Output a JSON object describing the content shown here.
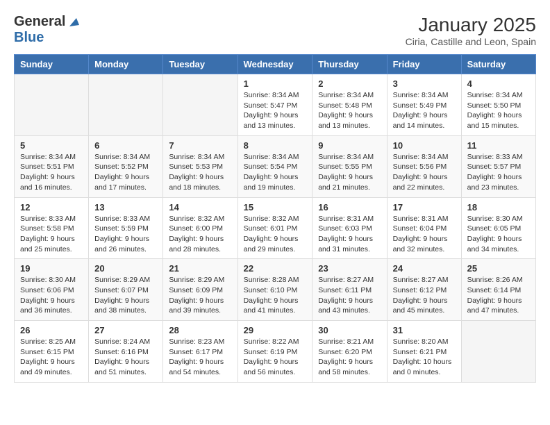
{
  "header": {
    "logo_line1": "General",
    "logo_line2": "Blue",
    "title": "January 2025",
    "subtitle": "Ciria, Castille and Leon, Spain"
  },
  "days_of_week": [
    "Sunday",
    "Monday",
    "Tuesday",
    "Wednesday",
    "Thursday",
    "Friday",
    "Saturday"
  ],
  "weeks": [
    [
      {
        "day": "",
        "info": ""
      },
      {
        "day": "",
        "info": ""
      },
      {
        "day": "",
        "info": ""
      },
      {
        "day": "1",
        "info": "Sunrise: 8:34 AM\nSunset: 5:47 PM\nDaylight: 9 hours and 13 minutes."
      },
      {
        "day": "2",
        "info": "Sunrise: 8:34 AM\nSunset: 5:48 PM\nDaylight: 9 hours and 13 minutes."
      },
      {
        "day": "3",
        "info": "Sunrise: 8:34 AM\nSunset: 5:49 PM\nDaylight: 9 hours and 14 minutes."
      },
      {
        "day": "4",
        "info": "Sunrise: 8:34 AM\nSunset: 5:50 PM\nDaylight: 9 hours and 15 minutes."
      }
    ],
    [
      {
        "day": "5",
        "info": "Sunrise: 8:34 AM\nSunset: 5:51 PM\nDaylight: 9 hours and 16 minutes."
      },
      {
        "day": "6",
        "info": "Sunrise: 8:34 AM\nSunset: 5:52 PM\nDaylight: 9 hours and 17 minutes."
      },
      {
        "day": "7",
        "info": "Sunrise: 8:34 AM\nSunset: 5:53 PM\nDaylight: 9 hours and 18 minutes."
      },
      {
        "day": "8",
        "info": "Sunrise: 8:34 AM\nSunset: 5:54 PM\nDaylight: 9 hours and 19 minutes."
      },
      {
        "day": "9",
        "info": "Sunrise: 8:34 AM\nSunset: 5:55 PM\nDaylight: 9 hours and 21 minutes."
      },
      {
        "day": "10",
        "info": "Sunrise: 8:34 AM\nSunset: 5:56 PM\nDaylight: 9 hours and 22 minutes."
      },
      {
        "day": "11",
        "info": "Sunrise: 8:33 AM\nSunset: 5:57 PM\nDaylight: 9 hours and 23 minutes."
      }
    ],
    [
      {
        "day": "12",
        "info": "Sunrise: 8:33 AM\nSunset: 5:58 PM\nDaylight: 9 hours and 25 minutes."
      },
      {
        "day": "13",
        "info": "Sunrise: 8:33 AM\nSunset: 5:59 PM\nDaylight: 9 hours and 26 minutes."
      },
      {
        "day": "14",
        "info": "Sunrise: 8:32 AM\nSunset: 6:00 PM\nDaylight: 9 hours and 28 minutes."
      },
      {
        "day": "15",
        "info": "Sunrise: 8:32 AM\nSunset: 6:01 PM\nDaylight: 9 hours and 29 minutes."
      },
      {
        "day": "16",
        "info": "Sunrise: 8:31 AM\nSunset: 6:03 PM\nDaylight: 9 hours and 31 minutes."
      },
      {
        "day": "17",
        "info": "Sunrise: 8:31 AM\nSunset: 6:04 PM\nDaylight: 9 hours and 32 minutes."
      },
      {
        "day": "18",
        "info": "Sunrise: 8:30 AM\nSunset: 6:05 PM\nDaylight: 9 hours and 34 minutes."
      }
    ],
    [
      {
        "day": "19",
        "info": "Sunrise: 8:30 AM\nSunset: 6:06 PM\nDaylight: 9 hours and 36 minutes."
      },
      {
        "day": "20",
        "info": "Sunrise: 8:29 AM\nSunset: 6:07 PM\nDaylight: 9 hours and 38 minutes."
      },
      {
        "day": "21",
        "info": "Sunrise: 8:29 AM\nSunset: 6:09 PM\nDaylight: 9 hours and 39 minutes."
      },
      {
        "day": "22",
        "info": "Sunrise: 8:28 AM\nSunset: 6:10 PM\nDaylight: 9 hours and 41 minutes."
      },
      {
        "day": "23",
        "info": "Sunrise: 8:27 AM\nSunset: 6:11 PM\nDaylight: 9 hours and 43 minutes."
      },
      {
        "day": "24",
        "info": "Sunrise: 8:27 AM\nSunset: 6:12 PM\nDaylight: 9 hours and 45 minutes."
      },
      {
        "day": "25",
        "info": "Sunrise: 8:26 AM\nSunset: 6:14 PM\nDaylight: 9 hours and 47 minutes."
      }
    ],
    [
      {
        "day": "26",
        "info": "Sunrise: 8:25 AM\nSunset: 6:15 PM\nDaylight: 9 hours and 49 minutes."
      },
      {
        "day": "27",
        "info": "Sunrise: 8:24 AM\nSunset: 6:16 PM\nDaylight: 9 hours and 51 minutes."
      },
      {
        "day": "28",
        "info": "Sunrise: 8:23 AM\nSunset: 6:17 PM\nDaylight: 9 hours and 54 minutes."
      },
      {
        "day": "29",
        "info": "Sunrise: 8:22 AM\nSunset: 6:19 PM\nDaylight: 9 hours and 56 minutes."
      },
      {
        "day": "30",
        "info": "Sunrise: 8:21 AM\nSunset: 6:20 PM\nDaylight: 9 hours and 58 minutes."
      },
      {
        "day": "31",
        "info": "Sunrise: 8:20 AM\nSunset: 6:21 PM\nDaylight: 10 hours and 0 minutes."
      },
      {
        "day": "",
        "info": ""
      }
    ]
  ]
}
